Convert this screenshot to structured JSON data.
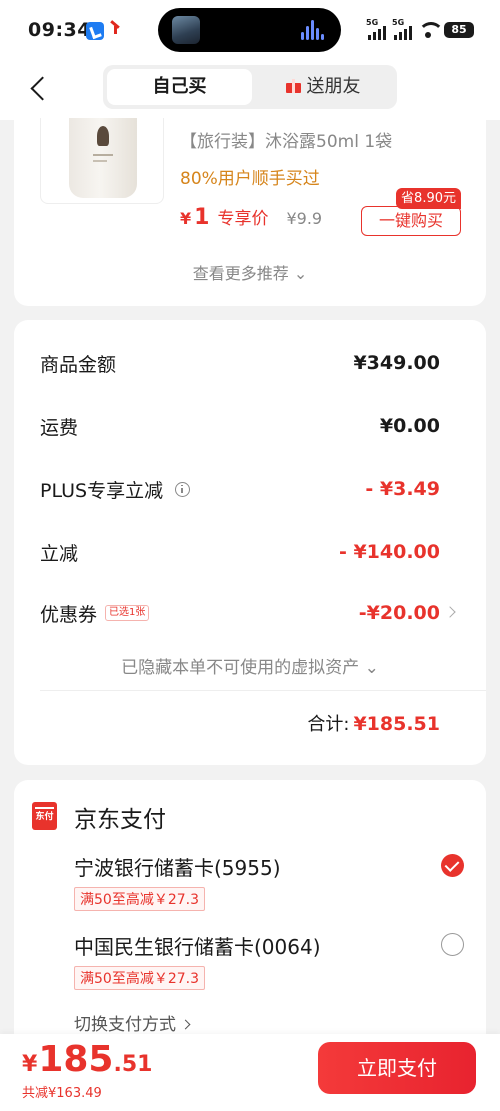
{
  "status_bar": {
    "time": "09:34",
    "battery": "85",
    "signal1": "5G",
    "signal2": "5G"
  },
  "nav": {
    "tabs": [
      {
        "label": "自己买",
        "active": true
      },
      {
        "label": "送朋友",
        "active": false
      }
    ]
  },
  "recommendation": {
    "title": "【旅行装】沐浴露50ml 1袋",
    "subtitle": "80%用户顺手买过",
    "price_symbol": "¥",
    "price": "1",
    "price_tag": "专享价",
    "original_price": "¥9.9",
    "save_badge": "省8.90元",
    "buy_button": "一键购买",
    "more": "查看更多推荐 ⌄"
  },
  "price_detail": {
    "rows": [
      {
        "label": "商品金额",
        "value": "¥349.00"
      },
      {
        "label": "运费",
        "value": "¥0.00"
      },
      {
        "label": "PLUS专享立减",
        "value": "- ¥3.49"
      },
      {
        "label": "立减",
        "value": "- ¥140.00"
      },
      {
        "label": "优惠券",
        "badge": "已选1张",
        "value": "-¥20.00"
      }
    ],
    "hidden_assets": "已隐藏本单不可使用的虚拟资产 ⌄",
    "total_label": "合计:",
    "total_value": "¥185.51"
  },
  "payment": {
    "icon_text": "东付",
    "title": "京东支付",
    "banks": [
      {
        "name": "宁波银行储蓄卡(5955)",
        "promo": "满50至高减￥27.3",
        "selected": true
      },
      {
        "name": "中国民生银行储蓄卡(0064)",
        "promo": "满50至高减￥27.3",
        "selected": false
      }
    ],
    "switch_label": "切换支付方式"
  },
  "bottom": {
    "yen": "¥",
    "amount_int": "185",
    "amount_dec": ".51",
    "saved": "共减¥163.49",
    "pay_button": "立即支付"
  },
  "colors": {
    "accent": "#e8332c",
    "promo_orange": "#d6851c",
    "background": "#f2f2f2"
  }
}
